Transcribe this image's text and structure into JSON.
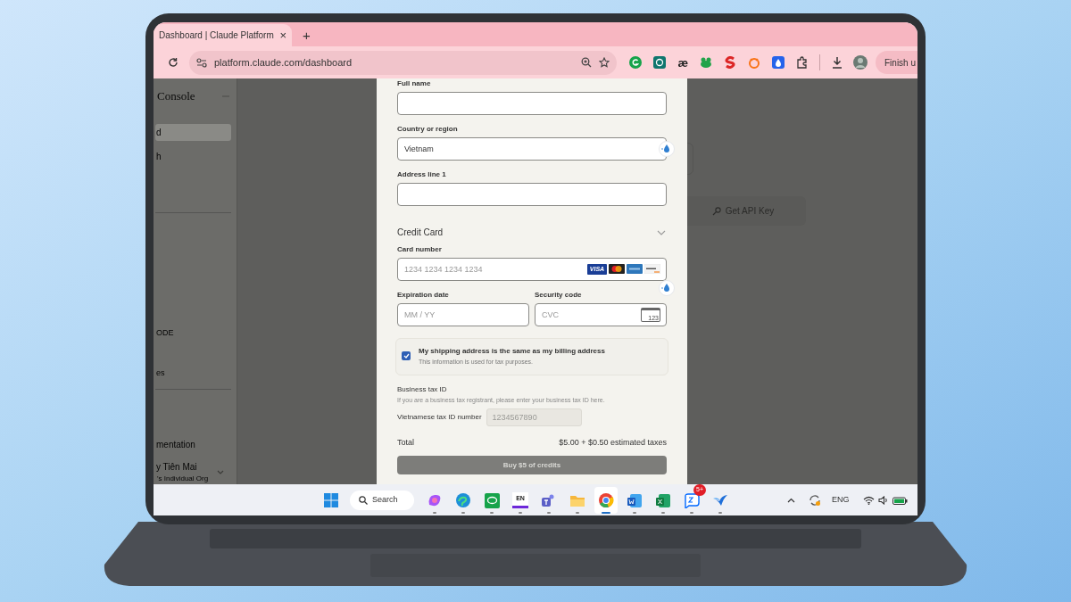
{
  "browser": {
    "tab": {
      "title": "Dashboard | Claude Platform",
      "close": "×",
      "selected": true
    },
    "new_tab": "+",
    "address": "platform.claude.com/dashboard",
    "extensions": [
      {
        "kind": "grammar"
      },
      {
        "kind": "chat"
      },
      {
        "kind": "glyph",
        "glyph": "æ"
      },
      {
        "kind": "puzzle"
      },
      {
        "kind": "letter"
      },
      {
        "kind": "ring"
      },
      {
        "kind": "drop"
      }
    ],
    "profile_button": "Finish u"
  },
  "sidebar": {
    "title": "Console",
    "items": [
      {
        "label": "d",
        "selected": true
      },
      {
        "label": "h",
        "selected": false
      }
    ],
    "section_items": [
      {
        "label": "ODE"
      },
      {
        "label": "es"
      }
    ],
    "footer_link": "mentation",
    "user": {
      "name": "y Tiên Mai",
      "org": "'s Individual Org"
    }
  },
  "background": {
    "button": "Get API Key"
  },
  "form": {
    "fields": [
      {
        "label": "Full name"
      },
      {
        "label": "Country or region",
        "value": "Vietnam",
        "autofill": true
      },
      {
        "label": "Address line 1"
      }
    ],
    "section": {
      "title": "Credit Card",
      "expanded": true
    },
    "card_number": {
      "label": "Card number",
      "placeholder": "1234 1234 1234 1234",
      "brands": [
        {
          "kind": "visa",
          "label": "VISA"
        },
        {
          "kind": "mastercard"
        },
        {
          "kind": "amex"
        },
        {
          "kind": "discover"
        }
      ]
    },
    "expiration": {
      "label": "Expiration date",
      "placeholder": "MM / YY"
    },
    "security": {
      "label": "Security code",
      "placeholder": "CVC",
      "icon_text": "123",
      "autofill": true
    },
    "same_address": {
      "label": "My shipping address is the same as my billing address",
      "hint": "This information is used for tax purposes.",
      "checked": true
    },
    "tax": {
      "title": "Business tax ID",
      "hint": "If you are a business tax registrant, please enter your business tax ID here.",
      "field_label": "Vietnamese tax ID number",
      "placeholder": "1234567890"
    },
    "total": {
      "label": "Total",
      "value": "$5.00 + $0.50 estimated taxes"
    },
    "submit": {
      "label": "Buy $5 of credits",
      "disabled": true
    }
  },
  "taskbar": {
    "search": "Search",
    "apps": [
      {
        "kind": "copilot",
        "selected": false
      },
      {
        "kind": "edge",
        "selected": false
      },
      {
        "kind": "chat",
        "selected": false
      },
      {
        "kind": "lang",
        "label": "EN",
        "selected": false
      },
      {
        "kind": "teams",
        "selected": false
      },
      {
        "kind": "folder",
        "selected": false
      },
      {
        "kind": "chrome",
        "selected": true
      },
      {
        "kind": "word",
        "selected": false
      },
      {
        "kind": "excel",
        "selected": false
      },
      {
        "kind": "zalo",
        "badge": "5+",
        "selected": false
      },
      {
        "kind": "bird",
        "selected": false
      }
    ],
    "language": "ENG"
  }
}
